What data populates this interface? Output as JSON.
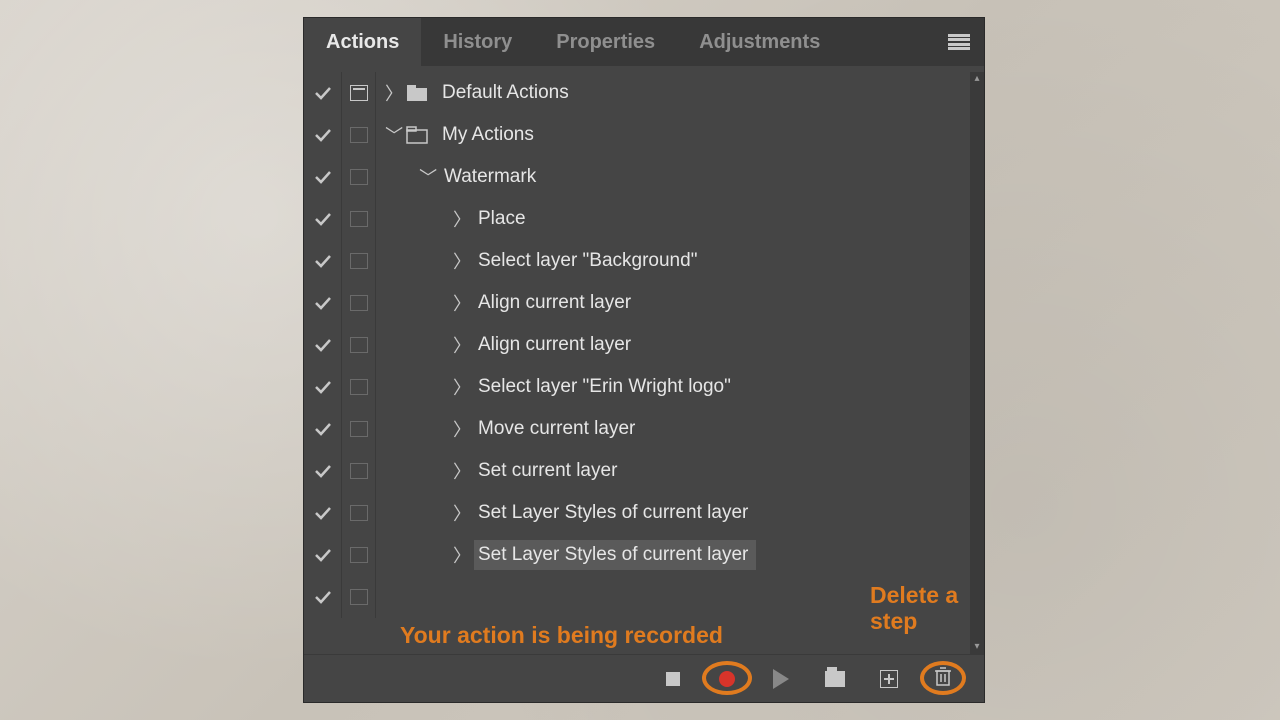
{
  "tabs": {
    "actions": "Actions",
    "history": "History",
    "properties": "Properties",
    "adjustments": "Adjustments"
  },
  "tree": {
    "default_actions": "Default Actions",
    "my_actions": "My Actions",
    "watermark": "Watermark",
    "steps": [
      "Place",
      "Select layer \"Background\"",
      "Align current layer",
      "Align current layer",
      "Select layer \"Erin Wright logo\"",
      "Move current layer",
      "Set current layer",
      "Set Layer Styles of current layer",
      "Set Layer Styles of current layer"
    ]
  },
  "annotations": {
    "recording": "Your action is being recorded",
    "delete": "Delete a step"
  },
  "colors": {
    "accent_orange": "#e07b1f",
    "record_red": "#d8342a",
    "panel_bg": "#454545"
  }
}
